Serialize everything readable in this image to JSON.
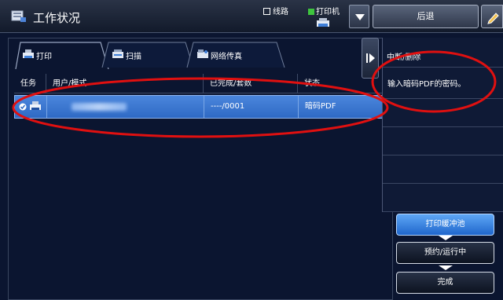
{
  "header": {
    "title": "工作状况",
    "status_line": "线路",
    "status_printer": "打印机",
    "back_label": "后退"
  },
  "tabs": [
    {
      "label": "打印",
      "icon": "print-icon"
    },
    {
      "label": "扫描",
      "icon": "scan-icon"
    },
    {
      "label": "网络传真",
      "icon": "fax-icon"
    }
  ],
  "table": {
    "headers": [
      "任务",
      "用户/模式",
      "已完成/套数",
      "状态"
    ],
    "rows": [
      {
        "user": "",
        "done": "----/0001",
        "status": "暗码PDF"
      }
    ]
  },
  "side_panel": {
    "menu_title": "中断/删除",
    "message": "输入暗码PDF的密码。"
  },
  "buttons": {
    "spool": "打印缓冲池",
    "queue": "预约/运行中",
    "done": "完成"
  },
  "colors": {
    "background": "#0b1530",
    "selected_row": "#3b78d4",
    "annotation": "#e01010"
  }
}
